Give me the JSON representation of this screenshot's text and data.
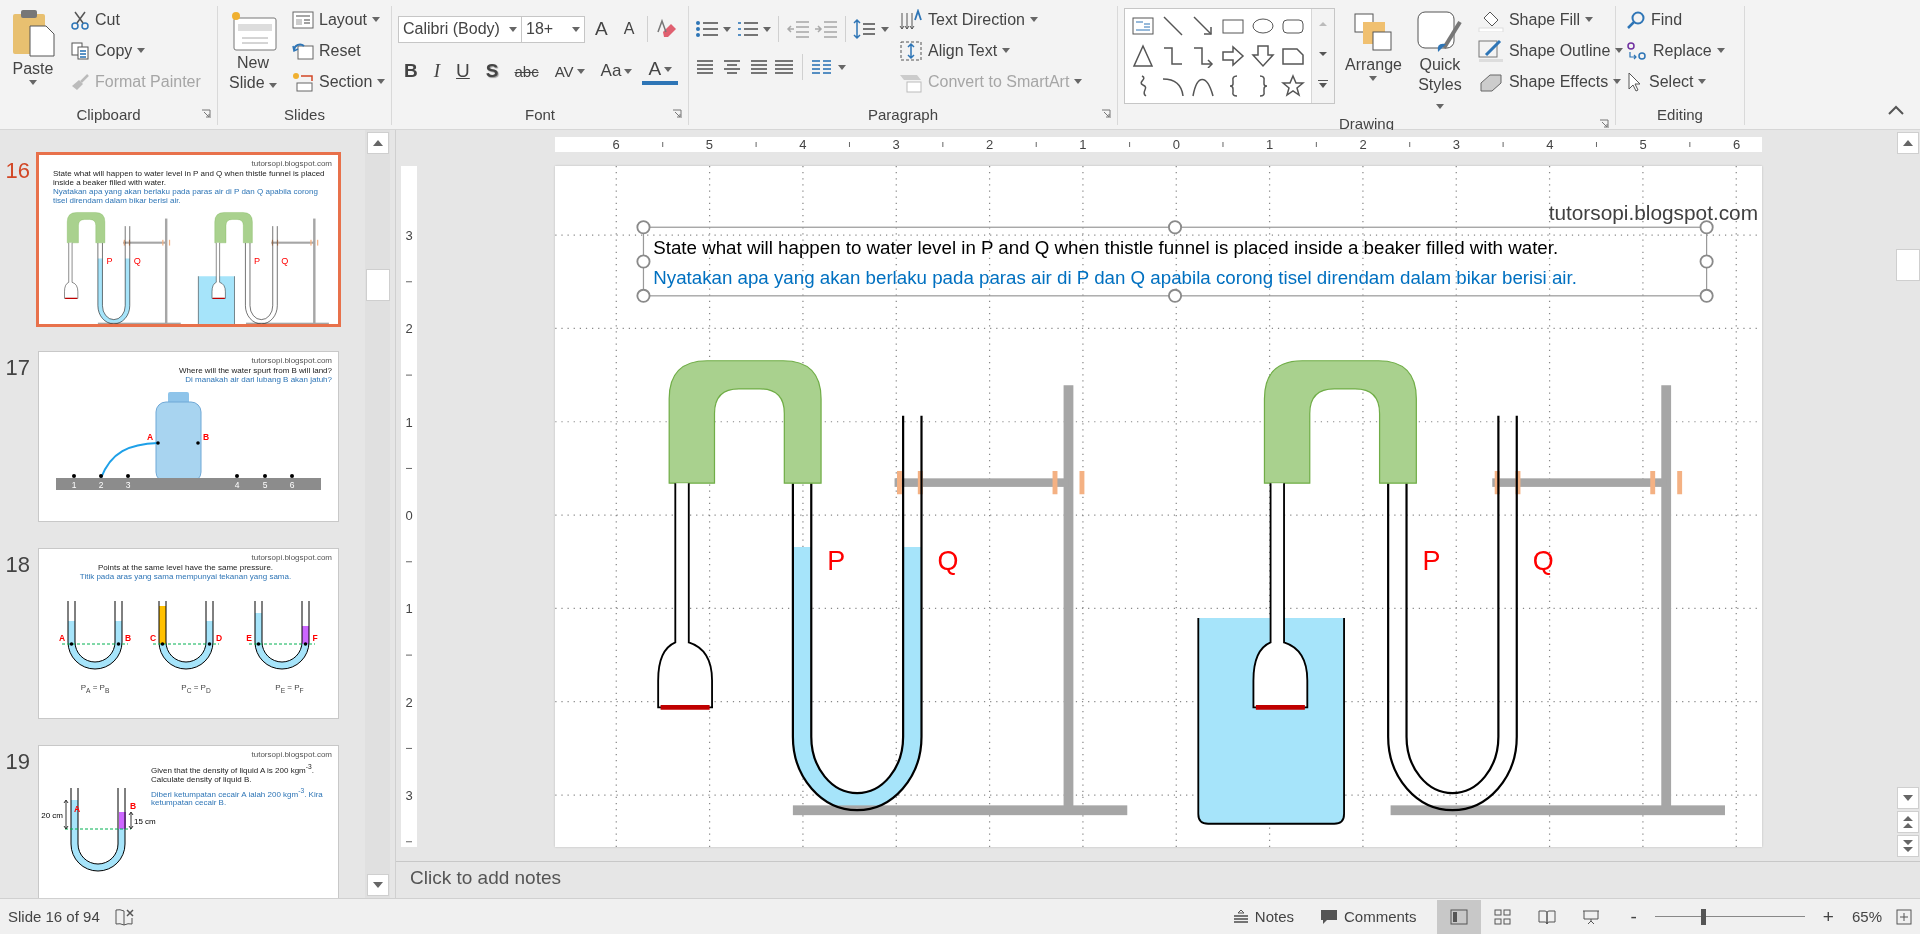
{
  "ribbon": {
    "clipboard": {
      "label": "Clipboard",
      "paste": "Paste",
      "cut": "Cut",
      "copy": "Copy",
      "format_painter": {
        "label": "Format Painter",
        "disabled": true
      }
    },
    "slides": {
      "label": "Slides",
      "new_slide": [
        "New",
        "Slide"
      ],
      "layout": "Layout",
      "reset": "Reset",
      "section": "Section"
    },
    "font": {
      "label": "Font",
      "font_name": "Calibri (Body)",
      "font_size": "18+",
      "grow": "A",
      "shrink": "A",
      "bold": "B",
      "italic": "I",
      "underline": "U",
      "shadow": "S",
      "strikethrough": "abc",
      "spacing": "AV",
      "change_case": "Aa",
      "font_color": "A"
    },
    "paragraph": {
      "label": "Paragraph",
      "text_direction": "Text Direction",
      "align_text": "Align Text",
      "smartart": {
        "label": "Convert to SmartArt",
        "disabled": true
      }
    },
    "drawing": {
      "label": "Drawing",
      "arrange": "Arrange",
      "quick_styles": [
        "Quick",
        "Styles"
      ],
      "shape_fill": "Shape Fill",
      "shape_outline": "Shape Outline",
      "shape_effects": "Shape Effects"
    },
    "editing": {
      "label": "Editing",
      "find": "Find",
      "replace": "Replace",
      "select": "Select"
    }
  },
  "thumbnails": [
    {
      "number": "16",
      "selected": true,
      "kind": "apparatus",
      "site": "tutorsopi.blogspot.com",
      "question": "State what will happen to water level in P and Q when thistle funnel is placed inside a beaker filled with water.",
      "translation": "Nyatakan apa yang akan berlaku pada paras air di P dan Q apabila corong tisel direndam dalam bikar berisi air.",
      "labels": [
        "P",
        "Q",
        "P",
        "Q"
      ]
    },
    {
      "number": "17",
      "selected": false,
      "kind": "bottle",
      "site": "tutorsopi.blogspot.com",
      "question": "Where will the water spurt from B will land?",
      "translation": "Di manakah air dari lubang B akan jatuh?",
      "labels": [
        "A",
        "B"
      ],
      "marks": [
        "1",
        "2",
        "3",
        "4",
        "5",
        "6"
      ]
    },
    {
      "number": "18",
      "selected": false,
      "kind": "pressure",
      "site": "tutorsopi.blogspot.com",
      "question": "Points at the same level have the same pressure.",
      "translation": "Titik pada aras yang sama mempunyai tekanan yang sama.",
      "labels": [
        "A",
        "B",
        "C",
        "D",
        "E",
        "F"
      ],
      "equations": [
        "P$_{A}$ = P$_{B}$",
        "P$_{C}$ = P$_{D}$",
        "P$_{E}$ = P$_{F}$"
      ]
    },
    {
      "number": "19",
      "selected": false,
      "kind": "density",
      "site": "tutorsopi.blogspot.com",
      "question": "Given that the density of liquid A is 200 kgm$^{-3}$. Calculate density of liquid B.",
      "translation": "Diberi ketumpatan cecair A ialah 200 kgm$^{-3}$. Kira ketumpatan cecair B.",
      "labels": [
        "A",
        "B"
      ],
      "measures": [
        "20 cm",
        "15 cm"
      ]
    }
  ],
  "ruler": {
    "horizontal": [
      "6",
      "5",
      "4",
      "3",
      "2",
      "1",
      "0",
      "1",
      "2",
      "3",
      "4",
      "5",
      "6"
    ],
    "vertical": [
      "3",
      "2",
      "1",
      "0",
      "1",
      "2",
      "3"
    ]
  },
  "slide": {
    "site": "tutorsopi.blogspot.com",
    "question": "State what will happen to water level in P and Q when thistle funnel is placed inside a beaker filled with water.",
    "translation": "Nyatakan apa yang akan berlaku pada paras air di P dan Q apabila corong tisel direndam dalam bikar berisi air.",
    "labels": [
      "P",
      "Q",
      "P",
      "Q"
    ]
  },
  "notes": {
    "placeholder": "Click to add notes"
  },
  "status_bar": {
    "slide_info": "Slide 16 of 94",
    "notes": "Notes",
    "comments": "Comments",
    "views": [
      {
        "kind": "normal",
        "selected": true
      },
      {
        "kind": "sorter",
        "selected": false
      },
      {
        "kind": "reading",
        "selected": false
      },
      {
        "kind": "slideshow",
        "selected": false
      }
    ],
    "zoom_out": "-",
    "zoom_in": "+",
    "zoom_slider": {
      "level": 0.32
    },
    "zoom": "65%"
  }
}
